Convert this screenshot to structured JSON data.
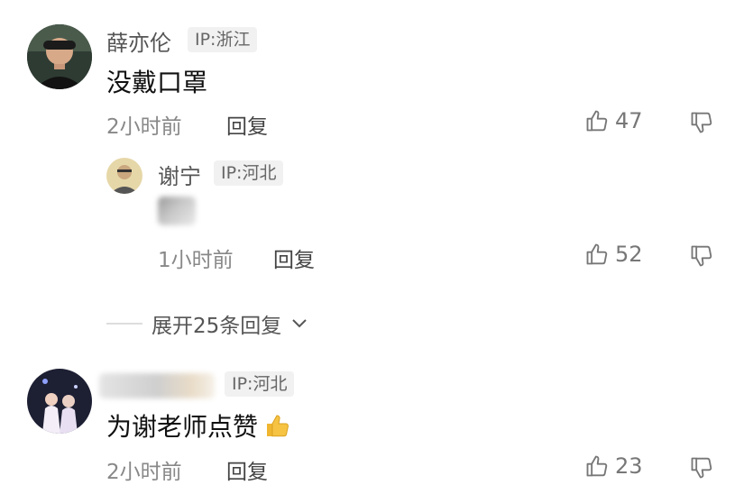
{
  "comments": [
    {
      "username": "薛亦伦",
      "ip": "IP:浙江",
      "content": "没戴口罩",
      "time": "2小时前",
      "reply_label": "回复",
      "likes": "47"
    },
    {
      "username": "",
      "ip": "IP:河北",
      "content": "为谢老师点赞",
      "time": "2小时前",
      "reply_label": "回复",
      "likes": "23"
    }
  ],
  "reply": {
    "username": "谢宁",
    "ip": "IP:河北",
    "time": "1小时前",
    "reply_label": "回复",
    "likes": "52"
  },
  "expand_label": "展开25条回复",
  "icons": {
    "like": "thumbs-up-icon",
    "dislike": "thumbs-down-icon",
    "expand": "chevron-down-icon",
    "emoji": "thumbs-up-emoji"
  },
  "colors": {
    "text_primary": "#111111",
    "text_secondary": "#888888",
    "badge_bg": "#f1f1f1",
    "emoji_yellow": "#f6c343"
  }
}
